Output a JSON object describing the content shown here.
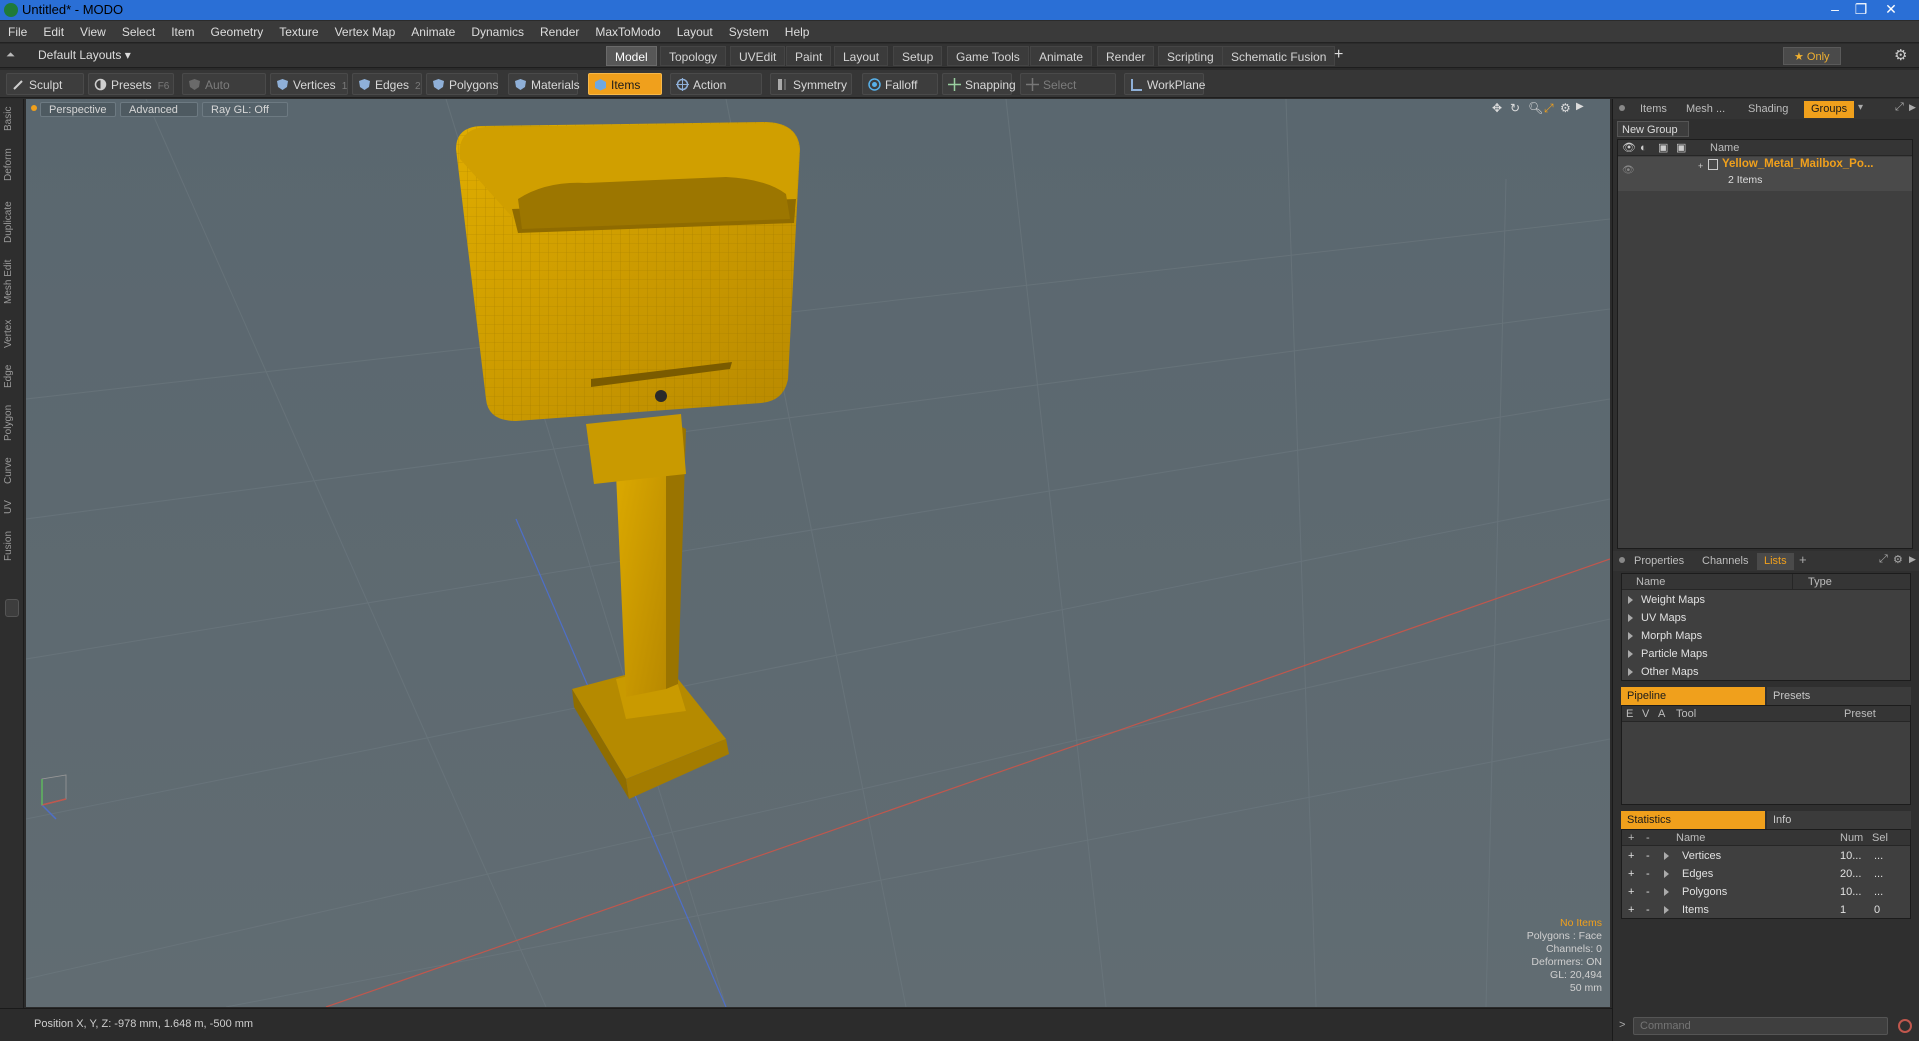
{
  "window": {
    "title": "Untitled* - MODO",
    "min": "–",
    "max": "❐",
    "close": "✕"
  },
  "menu": [
    "File",
    "Edit",
    "View",
    "Select",
    "Item",
    "Geometry",
    "Texture",
    "Vertex Map",
    "Animate",
    "Dynamics",
    "Render",
    "MaxToModo",
    "Layout",
    "System",
    "Help"
  ],
  "layoutbar": {
    "layout_select": "Default Layouts ▾",
    "tabs": [
      "Model",
      "Topology",
      "UVEdit",
      "Paint",
      "Layout",
      "Setup",
      "Game Tools",
      "Animate",
      "Render",
      "Scripting",
      "Schematic Fusion"
    ],
    "active_tab": "Model",
    "add": "+",
    "only": "★  Only",
    "gear": "⚙"
  },
  "toolbar": {
    "sculpt": "Sculpt",
    "presets": "Presets",
    "presets_key": "F6",
    "auto_select": "Auto Select",
    "vertices": "Vertices",
    "vertices_key": "1",
    "edges": "Edges",
    "edges_key": "2",
    "polygons": "Polygons",
    "materials": "Materials",
    "items": "Items",
    "action_center": "Action Center",
    "symmetry": "Symmetry",
    "falloff": "Falloff",
    "snapping": "Snapping",
    "select_through": "Select Through",
    "workplane": "WorkPlane"
  },
  "left_tabs": [
    "Basic",
    "Deform",
    "Duplicate",
    "Mesh Edit",
    "Vertex",
    "Edge",
    "Polygon",
    "Curve",
    "UV",
    "Fusion"
  ],
  "viewport": {
    "perspective": "Perspective",
    "advanced": "Advanced",
    "raygl": "Ray GL: Off",
    "hud": {
      "no_items": "No Items",
      "polygons": "Polygons : Face",
      "channels": "Channels: 0",
      "deformers": "Deformers: ON",
      "gl": "GL: 20,494",
      "scale": "50 mm"
    },
    "colors": {
      "bg": "#5d6b73",
      "mesh": "#d8a400"
    }
  },
  "status": {
    "position": "Position X, Y, Z:  -978 mm, 1.648 m, -500 mm"
  },
  "groups_panel": {
    "tabs": [
      "Items",
      "Mesh ...",
      "Shading",
      "Groups"
    ],
    "active": "Groups",
    "new_group": "New Group",
    "col_name": "Name",
    "item_name": "Yellow_Metal_Mailbox_Po...",
    "item_count": "2 Items"
  },
  "lists_panel": {
    "tabs": [
      "Properties",
      "Channels",
      "Lists"
    ],
    "active": "Lists",
    "add": "+",
    "col_name": "Name",
    "col_type": "Type",
    "rows": [
      "Weight Maps",
      "UV Maps",
      "Morph Maps",
      "Particle Maps",
      "Other Maps"
    ]
  },
  "pipeline_panel": {
    "tab_on": "Pipeline",
    "tab_off": "Presets",
    "cols": [
      "E",
      "V",
      "A",
      "Tool",
      "Preset"
    ]
  },
  "stats_panel": {
    "tab_on": "Statistics",
    "tab_off": "Info",
    "cols": {
      "plus": "+",
      "minus": "-",
      "name": "Name",
      "num": "Num",
      "sel": "Sel"
    },
    "rows": [
      {
        "name": "Vertices",
        "num": "10...",
        "sel": "..."
      },
      {
        "name": "Edges",
        "num": "20...",
        "sel": "..."
      },
      {
        "name": "Polygons",
        "num": "10...",
        "sel": "..."
      },
      {
        "name": "Items",
        "num": "1",
        "sel": "0"
      }
    ]
  },
  "command": {
    "placeholder": "Command"
  }
}
